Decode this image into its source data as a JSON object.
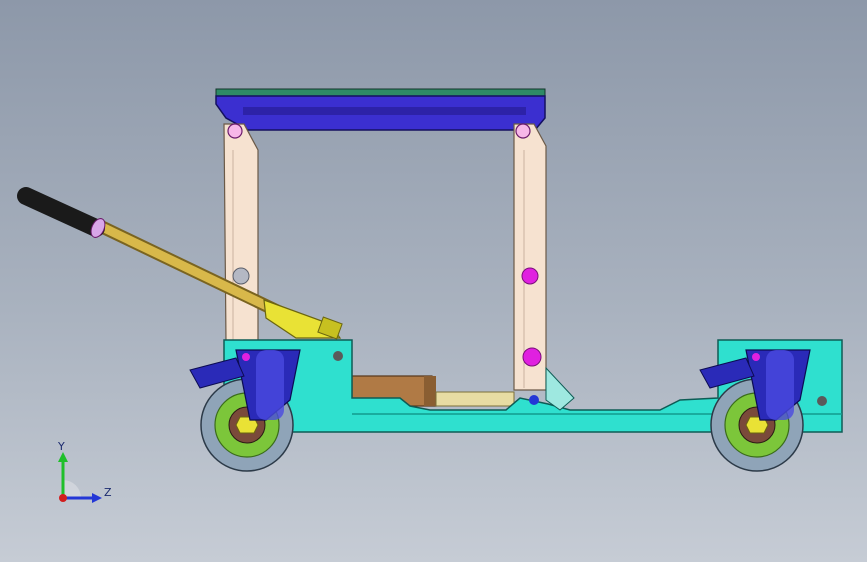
{
  "view": {
    "background_top": "#8d98a9",
    "background_bottom": "#c6ccd5"
  },
  "triad": {
    "y_label": "Y",
    "z_label": "Z",
    "y_color": "#1fbf2a",
    "z_color": "#2337d6",
    "x_color": "#d11d1d"
  },
  "colors": {
    "rack": "#3b2fd0",
    "rack_teeth": "#2e8a66",
    "lift_arm": "#f6e2d0",
    "base_frame": "#2fe0cf",
    "handle_tube": "#d8b84a",
    "handle_grip": "#1a1a1a",
    "pump": "#e9e235",
    "cylinder": "#b07a45",
    "caster_fork": "#2a2ab8",
    "wheel_tire": "#8fa4b8",
    "wheel_hub": "#7cc63a",
    "pivot_pin": "#e020e0"
  },
  "icons": {
    "triad": "coordinate-triad-icon"
  }
}
